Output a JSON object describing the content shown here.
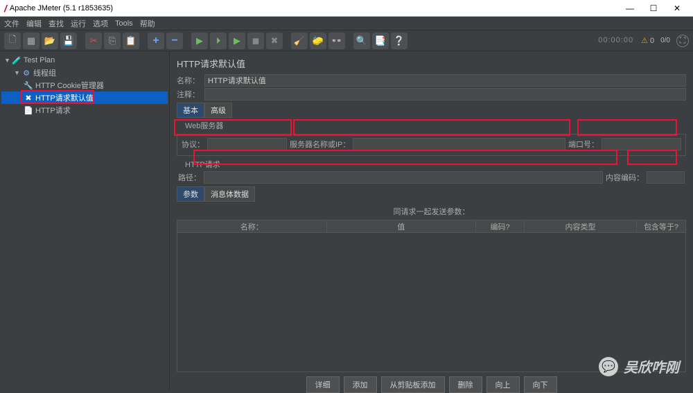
{
  "window": {
    "title": "Apache JMeter (5.1 r1853635)"
  },
  "menu": [
    "文件",
    "编辑",
    "查找",
    "运行",
    "选项",
    "Tools",
    "帮助"
  ],
  "timer": "00:00:00",
  "warn": {
    "icon": "⚠",
    "count1": "0",
    "count2": "0/0"
  },
  "tree": {
    "root": "Test Plan",
    "group": "线程组",
    "cookie": "HTTP Cookie管理器",
    "defaults": "HTTP请求默认值",
    "request": "HTTP请求"
  },
  "panel": {
    "title": "HTTP请求默认值",
    "name_lbl": "名称：",
    "name_val": "HTTP请求默认值",
    "comment_lbl": "注释：",
    "tab_basic": "基本",
    "tab_adv": "高级",
    "web_section": "Web服务器",
    "protocol_lbl": "协议：",
    "server_lbl": "服务器名称或IP：",
    "port_lbl": "端口号：",
    "http_section": "HTTP请求",
    "path_lbl": "路径：",
    "encoding_lbl": "内容编码：",
    "ptab_params": "参数",
    "ptab_body": "消息体数据",
    "params_header": "同请求一起发送参数：",
    "cols": {
      "name": "名称：",
      "value": "值",
      "encode": "编码?",
      "ctype": "内容类型",
      "include": "包含等于?"
    },
    "buttons": {
      "detail": "详细",
      "add": "添加",
      "clip": "从剪贴板添加",
      "del": "删除",
      "up": "向上",
      "down": "向下"
    }
  },
  "watermark": "吴欣咋刚"
}
